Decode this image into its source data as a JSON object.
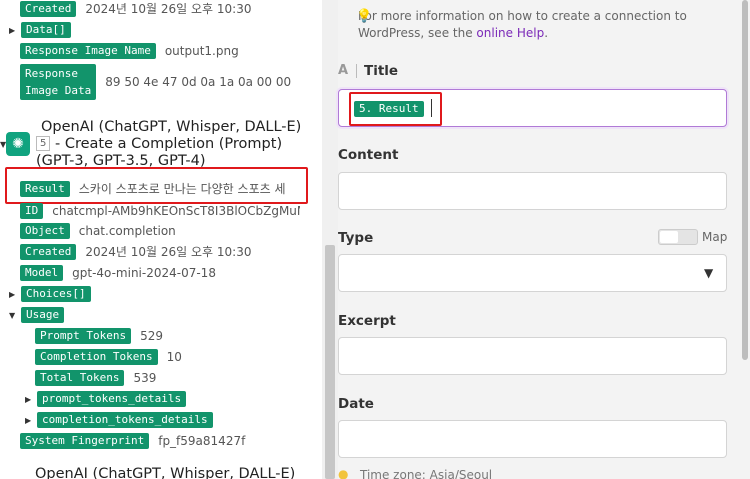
{
  "left": {
    "top_rows": [
      {
        "key": "Created",
        "value": "2024년 10월 26일 오후 10:30"
      },
      {
        "key": "Data[]",
        "value": ""
      },
      {
        "key": "Response Image Name",
        "value": "output1.png"
      },
      {
        "key_line1": "Response",
        "key_line2": "Image Data",
        "value": "89 50 4e 47 0d 0a 1a 0a 00 00 0"
      }
    ],
    "module": {
      "title_line1": "OpenAI (ChatGPT, Whisper, DALL-E)",
      "number": "5",
      "title_line2": "- Create a Completion (Prompt)",
      "title_line3": "(GPT-3, GPT-3.5, GPT-4)"
    },
    "rows": [
      {
        "key": "Result",
        "value": "스카이 스포츠로 만나는 다양한 스포츠 세"
      },
      {
        "key": "ID",
        "value": "chatcmpl-AMb9hKEOnScT8I3BlOCbZgMuM"
      },
      {
        "key": "Object",
        "value": "chat.completion"
      },
      {
        "key": "Created",
        "value": "2024년 10월 26일 오후 10:30"
      },
      {
        "key": "Model",
        "value": "gpt-4o-mini-2024-07-18"
      },
      {
        "key": "Choices[]",
        "value": ""
      },
      {
        "key": "Usage",
        "value": ""
      },
      {
        "key": "Prompt Tokens",
        "value": "529"
      },
      {
        "key": "Completion Tokens",
        "value": "10"
      },
      {
        "key": "Total Tokens",
        "value": "539"
      },
      {
        "key": "prompt_tokens_details",
        "value": ""
      },
      {
        "key": "completion_tokens_details",
        "value": ""
      },
      {
        "key": "System Fingerprint",
        "value": "fp_f59a81427f"
      }
    ],
    "next_module_title": "OpenAI (ChatGPT, Whisper, DALL-E)"
  },
  "right": {
    "help_text": "For more information on how to create a connection to WordPress, see the",
    "help_link": "online Help",
    "help_end": ".",
    "title_label": "Title",
    "title_icon": "A",
    "title_value_pill": "5. Result",
    "content_label": "Content",
    "type_label": "Type",
    "map_label": "Map",
    "excerpt_label": "Excerpt",
    "date_label": "Date",
    "timezone_text": "Time zone: Asia/Seoul"
  },
  "colors": {
    "pill": "#12946b",
    "highlight": "#e0191c",
    "link": "#7b2ab8",
    "focus": "#b07ad6"
  }
}
